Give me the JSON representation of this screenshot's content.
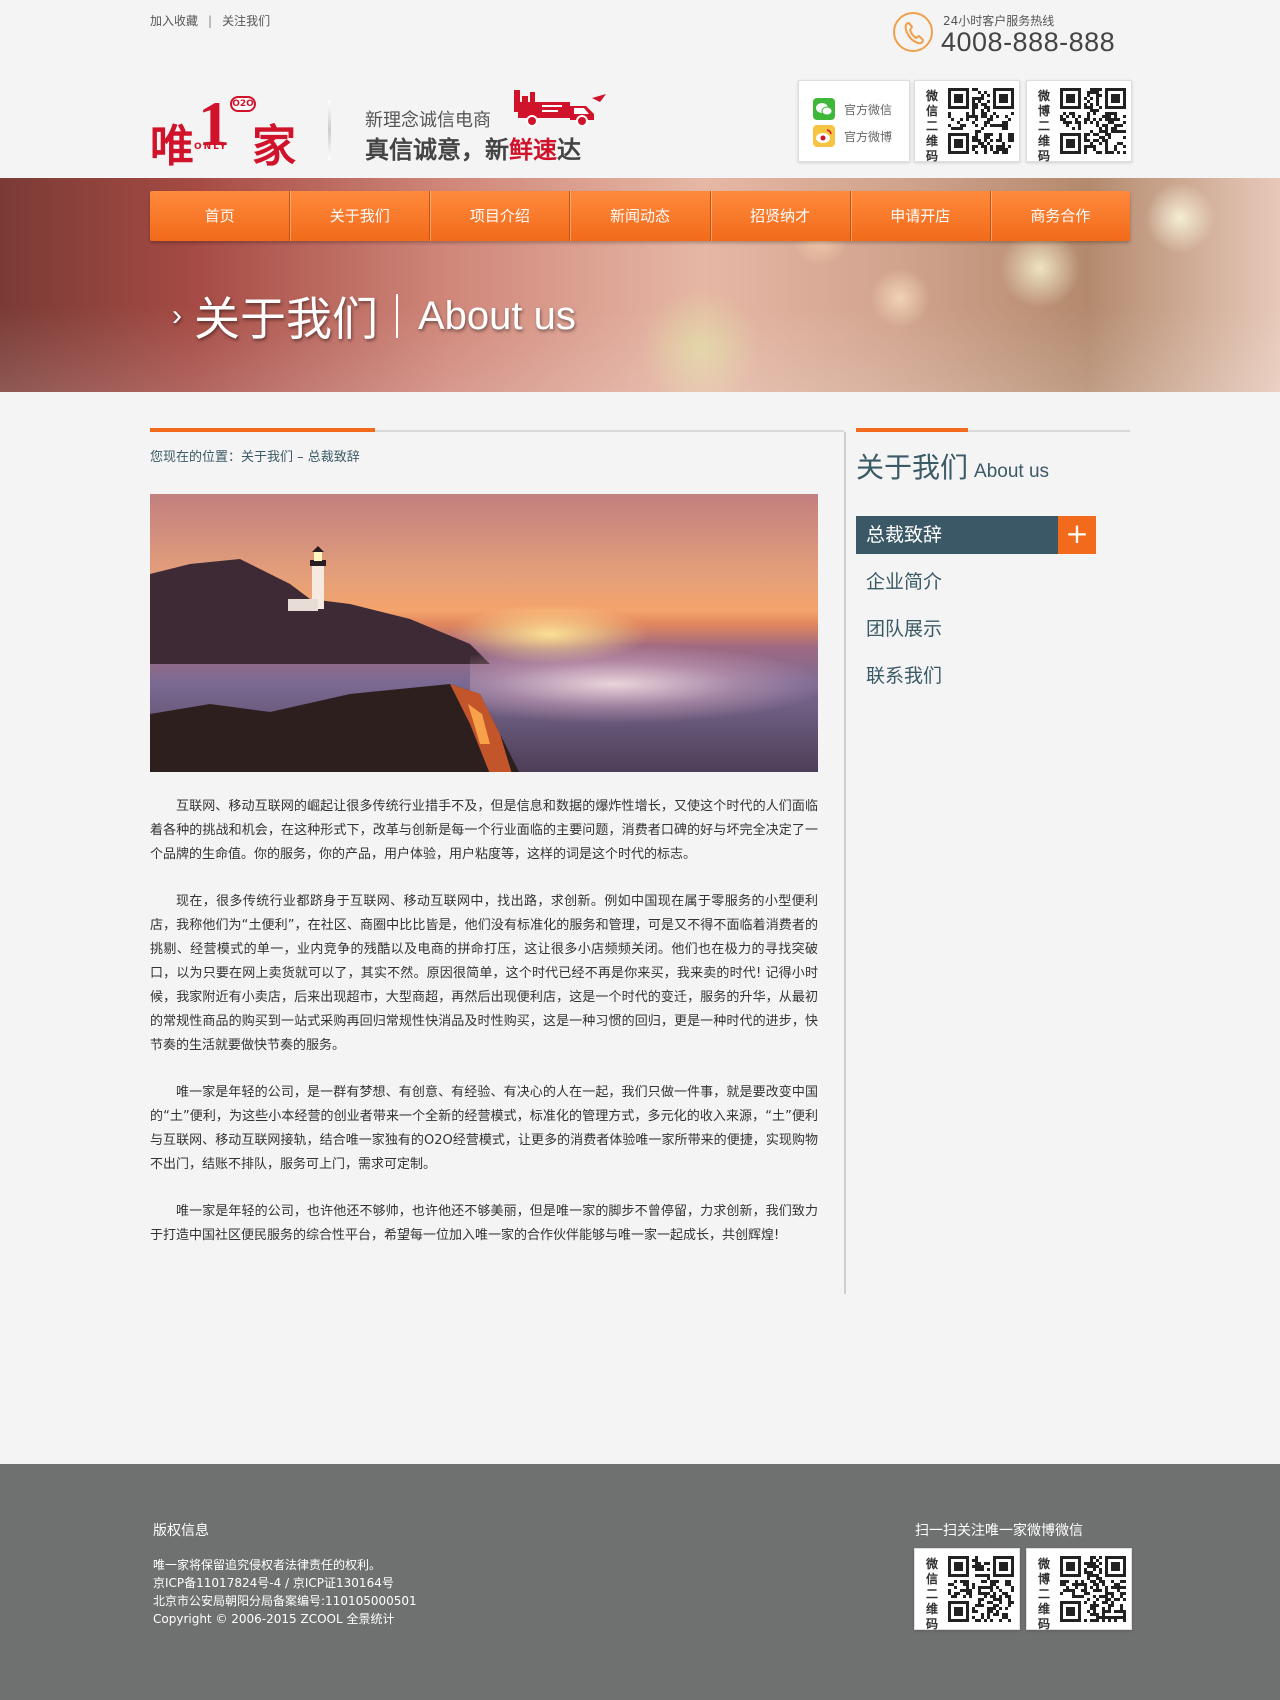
{
  "topbar": {
    "favorite": "加入收藏",
    "separator": "|",
    "follow": "关注我们"
  },
  "hotline": {
    "label": "24小时客户服务热线",
    "number": "4008-888-888"
  },
  "logo": {
    "wei": "唯",
    "one": "1",
    "jia": "家",
    "o2o": "O2O",
    "only": "ONLY"
  },
  "slogan": {
    "top": "新理念诚信电商",
    "main_prefix": "真信诚意，新",
    "main_highlight": "鲜速",
    "main_suffix": "达"
  },
  "social": {
    "wechat_label": "官方微信",
    "weibo_label": "官方微博"
  },
  "qr_header": [
    {
      "label": "微信二维码"
    },
    {
      "label": "微博二维码"
    }
  ],
  "nav": {
    "items": [
      "首页",
      "关于我们",
      "项目介绍",
      "新闻动态",
      "招贤纳才",
      "申请开店",
      "商务合作"
    ]
  },
  "banner": {
    "chevron": "›",
    "title_cn": "关于我们",
    "title_en": "About us"
  },
  "breadcrumb": {
    "prefix": "您现在的位置：",
    "section": "关于我们",
    "dash": " – ",
    "page": "总裁致辞"
  },
  "article": {
    "paragraphs": [
      "互联网、移动互联网的崛起让很多传统行业措手不及，但是信息和数据的爆炸性增长，又使这个时代的人们面临着各种的挑战和机会，在这种形式下，改革与创新是每一个行业面临的主要问题，消费者口碑的好与坏完全决定了一个品牌的生命值。你的服务，你的产品，用户体验，用户粘度等，这样的词是这个时代的标志。",
      "现在，很多传统行业都跻身于互联网、移动互联网中，找出路，求创新。例如中国现在属于零服务的小型便利店，我称他们为“土便利”，在社区、商圈中比比皆是，他们没有标准化的服务和管理，可是又不得不面临着消费者的挑剔、经营模式的单一，业内竞争的残酷以及电商的拼命打压，这让很多小店频频关闭。他们也在极力的寻找突破口，以为只要在网上卖货就可以了，其实不然。原因很简单，这个时代已经不再是你来买，我来卖的时代! 记得小时候，我家附近有小卖店，后来出现超市，大型商超，再然后出现便利店，这是一个时代的变迁，服务的升华，从最初的常规性商品的购买到一站式采购再回归常规性快消品及时性购买，这是一种习惯的回归，更是一种时代的进步，快节奏的生活就要做快节奏的服务。",
      "唯一家是年轻的公司，是一群有梦想、有创意、有经验、有决心的人在一起，我们只做一件事，就是要改变中国的“土”便利，为这些小本经营的创业者带来一个全新的经营模式，标准化的管理方式，多元化的收入来源，“土”便利与互联网、移动互联网接轨，结合唯一家独有的O2O经营模式，让更多的消费者体验唯一家所带来的便捷，实现购物不出门，结账不排队，服务可上门，需求可定制。",
      "唯一家是年轻的公司，也许他还不够帅，也许他还不够美丽，但是唯一家的脚步不曾停留，力求创新，我们致力于打造中国社区便民服务的综合性平台，希望每一位加入唯一家的合作伙伴能够与唯一家一起成长，共创辉煌!"
    ]
  },
  "sidebar": {
    "title_cn": "关于我们",
    "title_en": "About us",
    "plus": "+",
    "items": [
      {
        "label": "总裁致辞",
        "active": true
      },
      {
        "label": "企业简介",
        "active": false
      },
      {
        "label": "团队展示",
        "active": false
      },
      {
        "label": "联系我们",
        "active": false
      }
    ]
  },
  "footer": {
    "title": "版权信息",
    "lines": [
      "唯一家将保留追究侵权者法律责任的权利。",
      "京ICP备11017824号-4 / 京ICP证130164号",
      "北京市公安局朝阳分局备案编号:110105000501",
      "Copyright © 2006-2015 ZCOOL 全景统计"
    ],
    "scan_text": "扫一扫关注唯一家微博微信",
    "qr": [
      {
        "label": "微信二维码"
      },
      {
        "label": "微博二维码"
      }
    ]
  },
  "colors": {
    "brand_red": "#d0132a",
    "accent_orange": "#f26a1b",
    "teal_text": "#3a5a66",
    "footer_bg": "#6f7170"
  },
  "icons": [
    "phone-icon",
    "wechat-icon",
    "weibo-icon",
    "qr-code-icon",
    "truck-icon",
    "chevron-right-icon",
    "plus-icon"
  ]
}
